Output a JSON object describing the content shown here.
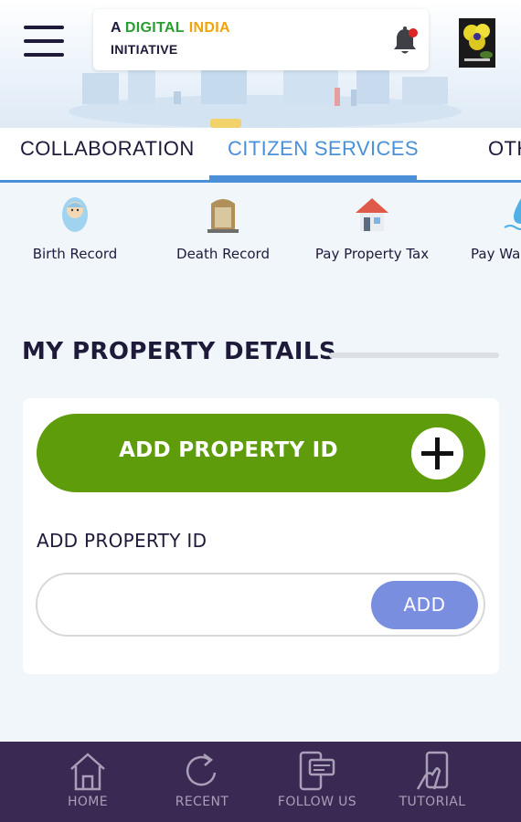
{
  "header": {
    "brand": {
      "prefix": "A",
      "digital": "DIGITAL",
      "india": "INDIA",
      "line2": "INITIATIVE"
    },
    "notification_dot_color": "#e02424"
  },
  "tabs": [
    {
      "label": "COLLABORATION",
      "active": false
    },
    {
      "label": "CITIZEN SERVICES",
      "active": true
    },
    {
      "label": "OTH",
      "active": false
    }
  ],
  "services": [
    {
      "label": "Birth Record",
      "icon": "baby-icon"
    },
    {
      "label": "Death Record",
      "icon": "tombstone-icon"
    },
    {
      "label": "Pay Property Tax",
      "icon": "house-icon"
    },
    {
      "label": "Pay Wa",
      "icon": "water-icon"
    }
  ],
  "section": {
    "title": "MY PROPERTY DETAILS"
  },
  "card": {
    "add_button_label": "ADD PROPERTY ID",
    "field_label": "ADD PROPERTY ID",
    "input_value": "",
    "input_placeholder": "",
    "submit_label": "ADD"
  },
  "bottom_nav": [
    {
      "label": "HOME",
      "icon": "home-icon"
    },
    {
      "label": "RECENT",
      "icon": "recent-icon"
    },
    {
      "label": "FOLLOW US",
      "icon": "follow-us-icon"
    },
    {
      "label": "TUTORIAL",
      "icon": "tutorial-icon"
    }
  ],
  "colors": {
    "accent_blue": "#4a90d9",
    "add_green": "#5e9c0b",
    "add_submit": "#7a8ee0",
    "nav_bg": "#3a2952",
    "brand_green": "#2a9d2f",
    "brand_orange": "#f0a30a"
  }
}
